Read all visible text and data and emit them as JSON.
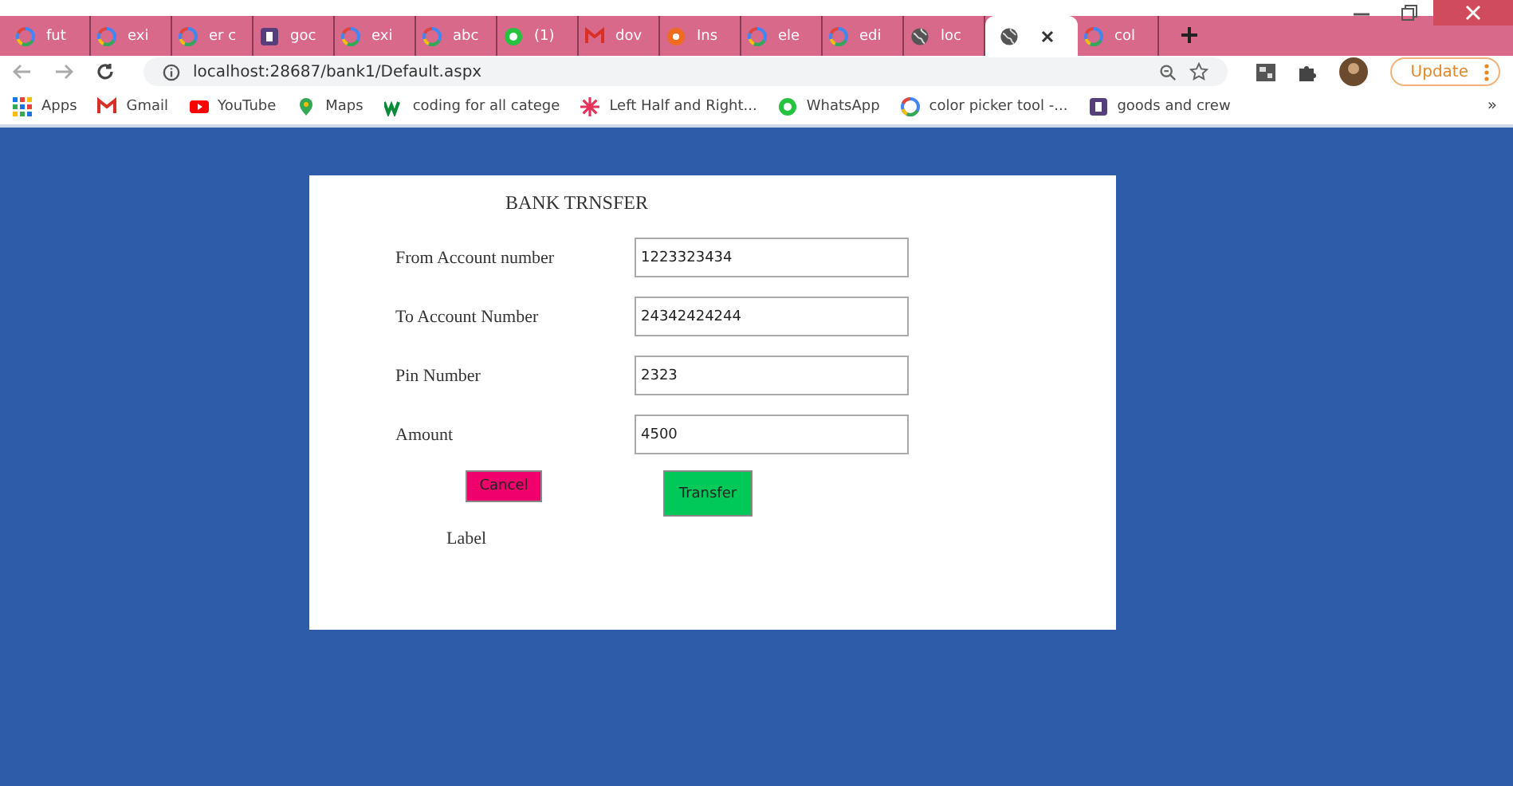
{
  "browser": {
    "tabs": [
      {
        "title": "fut",
        "kind": "google",
        "selected": false
      },
      {
        "title": "exi",
        "kind": "google",
        "selected": false
      },
      {
        "title": "er c",
        "kind": "google",
        "selected": false
      },
      {
        "title": "goc",
        "kind": "bootstrap",
        "selected": false
      },
      {
        "title": "exi",
        "kind": "google",
        "selected": false
      },
      {
        "title": "abc",
        "kind": "google",
        "selected": false
      },
      {
        "title": "(1)",
        "kind": "whatsapp",
        "selected": false
      },
      {
        "title": "dov",
        "kind": "gmail",
        "selected": false
      },
      {
        "title": "Ins",
        "kind": "orange",
        "selected": false
      },
      {
        "title": "ele",
        "kind": "google",
        "selected": false
      },
      {
        "title": "edi",
        "kind": "google",
        "selected": false
      },
      {
        "title": "loc",
        "kind": "globe",
        "selected": false
      },
      {
        "kind": "globe",
        "selected": true
      },
      {
        "title": "col",
        "kind": "google",
        "selected": false
      }
    ],
    "address": "localhost:28687/bank1/Default.aspx",
    "update": "Update",
    "bookmarks": [
      {
        "label": "Apps",
        "kind": "apps"
      },
      {
        "label": "Gmail",
        "kind": "gmail"
      },
      {
        "label": "YouTube",
        "kind": "youtube"
      },
      {
        "label": "Maps",
        "kind": "maps"
      },
      {
        "label": "coding for all catege",
        "kind": "w"
      },
      {
        "label": "Left Half and Right...",
        "kind": "star"
      },
      {
        "label": "WhatsApp",
        "kind": "whatsapp"
      },
      {
        "label": "color picker tool -...",
        "kind": "google"
      },
      {
        "label": "goods and crew",
        "kind": "bootstrap"
      }
    ],
    "bookmarks_more": "»"
  },
  "form": {
    "title": "BANK TRNSFER",
    "fields": [
      {
        "label": "From Account number",
        "value": "1223323434"
      },
      {
        "label": "To Account Number",
        "value": "24342424244"
      },
      {
        "label": "Pin Number",
        "value": "2323"
      },
      {
        "label": "Amount",
        "value": "4500"
      }
    ],
    "buttons": [
      {
        "label": "Cancel",
        "color": "#f0006a",
        "kind": "small"
      },
      {
        "label": "Transfer",
        "color": "#00c95a",
        "kind": "tall"
      }
    ],
    "status_label": "Label"
  }
}
